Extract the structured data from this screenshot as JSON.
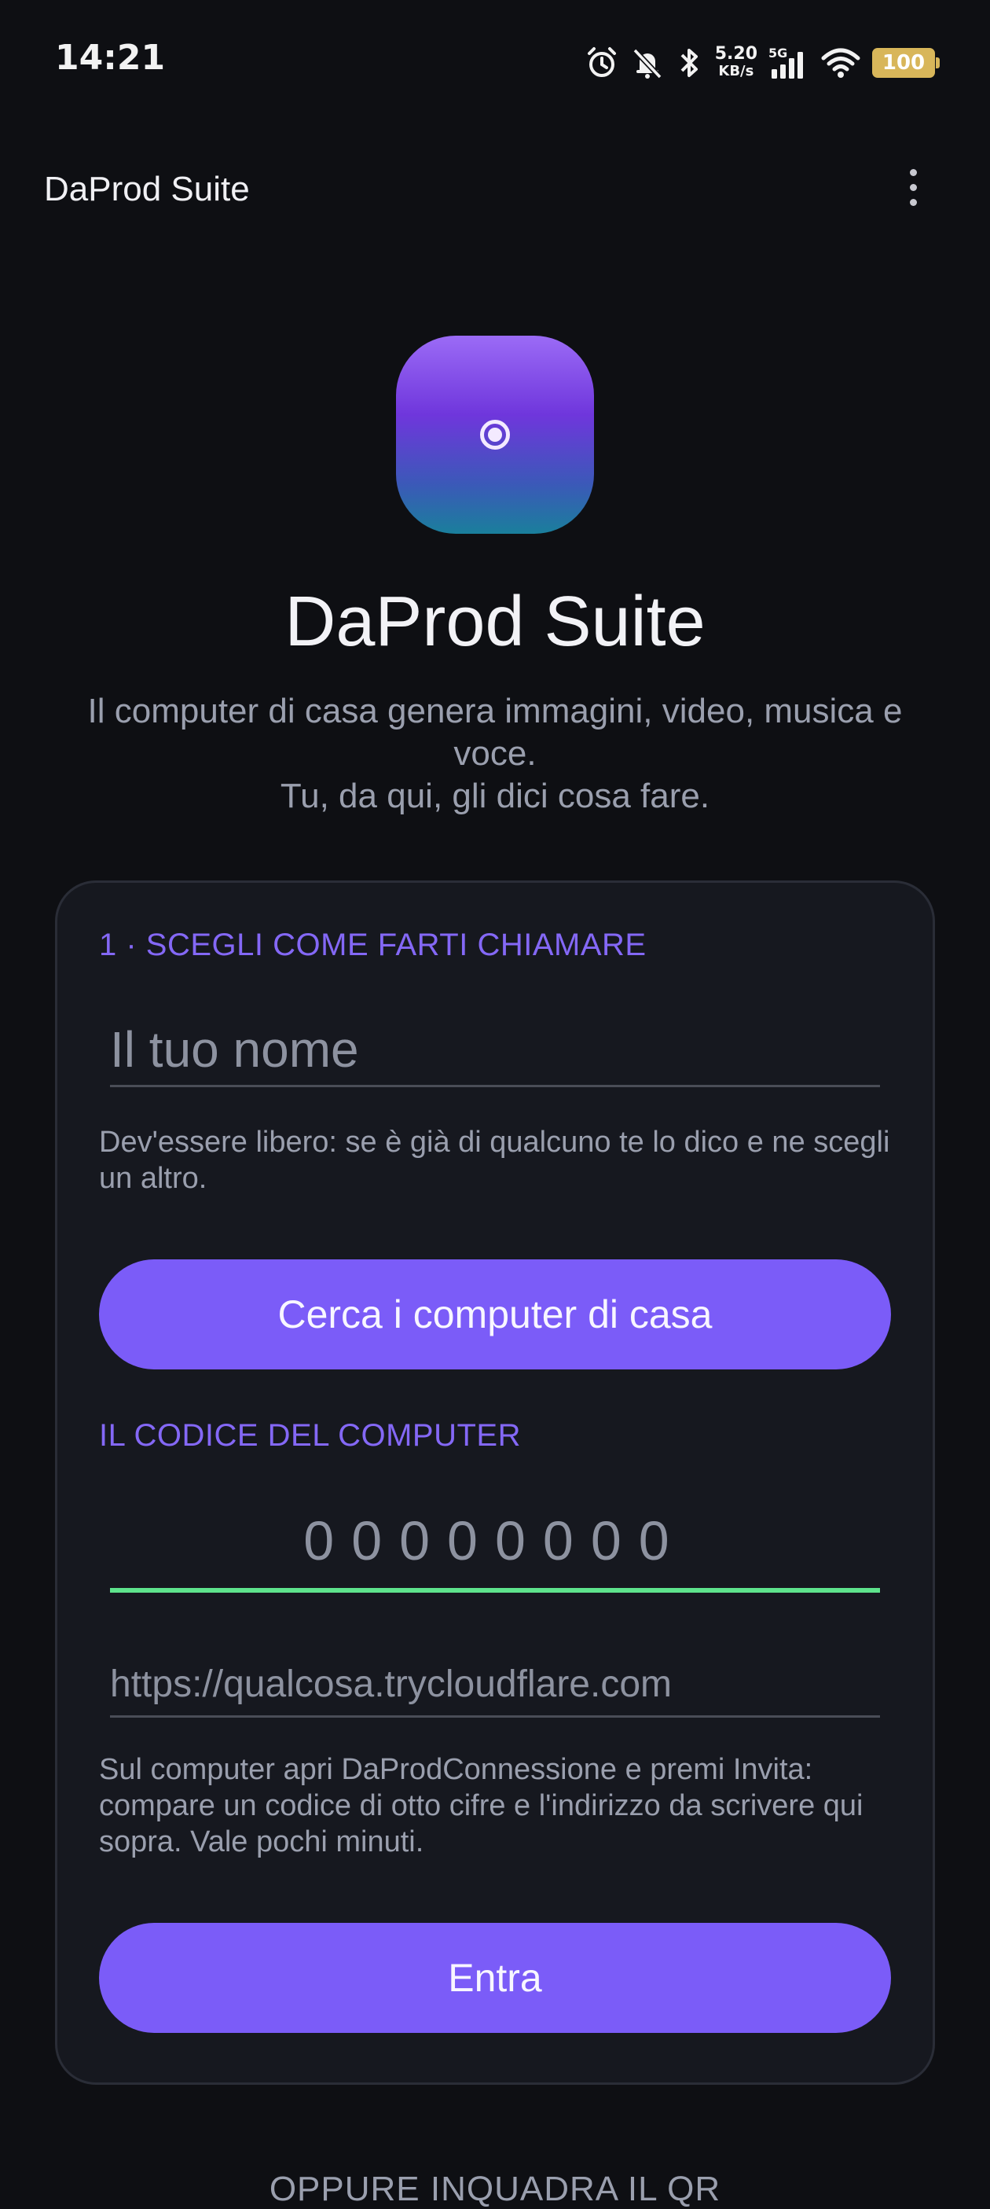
{
  "status_bar": {
    "time": "14:21",
    "net_speed_value": "5.20",
    "net_speed_unit": "KB/s",
    "network_type": "5G",
    "battery_level": "100",
    "icons": [
      "alarm-icon",
      "bell-muted-icon",
      "bluetooth-icon",
      "signal-icon",
      "wifi-icon",
      "battery-icon"
    ]
  },
  "app_bar": {
    "title": "DaProd Suite",
    "menu_icon": "more-vert-icon"
  },
  "hero": {
    "title": "DaProd Suite",
    "subtitle_line1": "Il computer di casa genera immagini, video, musica e voce.",
    "subtitle_line2": "Tu, da qui, gli dici cosa fare."
  },
  "form": {
    "name_section_label": "1 · SCEGLI COME FARTI CHIAMARE",
    "name_placeholder": "Il tuo nome",
    "name_value": "",
    "name_helper": "Dev'essere libero: se è già di qualcuno te lo dico e ne scegli un altro.",
    "search_button_label": "Cerca i computer di casa",
    "code_section_label": "IL CODICE DEL COMPUTER",
    "code_placeholder": "00000000",
    "code_value": "",
    "url_placeholder": "https://qualcosa.trycloudflare.com",
    "url_value": "",
    "code_helper": "Sul computer apri DaProdConnessione e premi Invita: compare un codice di otto cifre e l'indirizzo da scrivere qui sopra. Vale pochi minuti.",
    "enter_button_label": "Entra"
  },
  "footer": {
    "qr_label": "OPPURE INQUADRA IL QR"
  },
  "colors": {
    "background": "#0e0f13",
    "card": "#16181f",
    "accent": "#7b5cf8",
    "active_underline": "#5ee38c",
    "muted_text": "#9a9fae"
  }
}
